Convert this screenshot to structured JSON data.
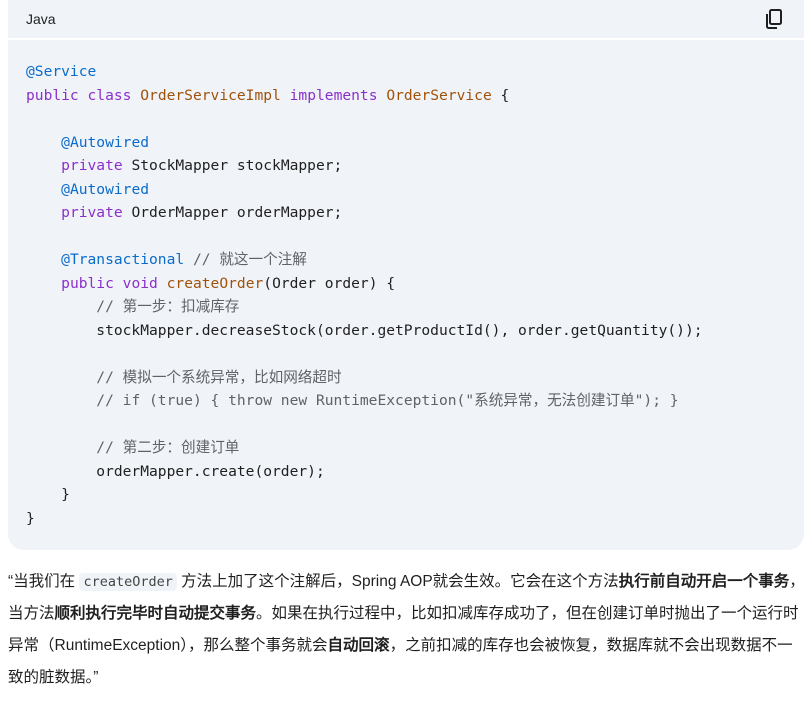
{
  "code_block": {
    "language": "Java",
    "copy_icon": "copy-icon",
    "lines": [
      [
        {
          "t": "anno",
          "v": "@Service"
        }
      ],
      [
        {
          "t": "kw",
          "v": "public"
        },
        {
          "t": "p",
          "v": " "
        },
        {
          "t": "kw",
          "v": "class"
        },
        {
          "t": "p",
          "v": " "
        },
        {
          "t": "type",
          "v": "OrderServiceImpl"
        },
        {
          "t": "p",
          "v": " "
        },
        {
          "t": "kw",
          "v": "implements"
        },
        {
          "t": "p",
          "v": " "
        },
        {
          "t": "type",
          "v": "OrderService"
        },
        {
          "t": "p",
          "v": " {"
        }
      ],
      [
        {
          "t": "p",
          "v": ""
        }
      ],
      [
        {
          "t": "p",
          "v": "    "
        },
        {
          "t": "anno",
          "v": "@Autowired"
        }
      ],
      [
        {
          "t": "p",
          "v": "    "
        },
        {
          "t": "kw",
          "v": "private"
        },
        {
          "t": "p",
          "v": " StockMapper stockMapper;"
        }
      ],
      [
        {
          "t": "p",
          "v": "    "
        },
        {
          "t": "anno",
          "v": "@Autowired"
        }
      ],
      [
        {
          "t": "p",
          "v": "    "
        },
        {
          "t": "kw",
          "v": "private"
        },
        {
          "t": "p",
          "v": " OrderMapper orderMapper;"
        }
      ],
      [
        {
          "t": "p",
          "v": ""
        }
      ],
      [
        {
          "t": "p",
          "v": "    "
        },
        {
          "t": "anno",
          "v": "@Transactional"
        },
        {
          "t": "p",
          "v": " "
        },
        {
          "t": "cm",
          "v": "// 就这一个注解"
        }
      ],
      [
        {
          "t": "p",
          "v": "    "
        },
        {
          "t": "kw",
          "v": "public"
        },
        {
          "t": "p",
          "v": " "
        },
        {
          "t": "kw",
          "v": "void"
        },
        {
          "t": "p",
          "v": " "
        },
        {
          "t": "fn",
          "v": "createOrder"
        },
        {
          "t": "p",
          "v": "(Order order) {"
        }
      ],
      [
        {
          "t": "p",
          "v": "        "
        },
        {
          "t": "cm",
          "v": "// 第一步：扣减库存"
        }
      ],
      [
        {
          "t": "p",
          "v": "        stockMapper.decreaseStock(order.getProductId(), order.getQuantity());"
        }
      ],
      [
        {
          "t": "p",
          "v": ""
        }
      ],
      [
        {
          "t": "p",
          "v": "        "
        },
        {
          "t": "cm",
          "v": "// 模拟一个系统异常，比如网络超时"
        }
      ],
      [
        {
          "t": "p",
          "v": "        "
        },
        {
          "t": "cm",
          "v": "// if (true) { throw new RuntimeException(\"系统异常，无法创建订单\"); }"
        }
      ],
      [
        {
          "t": "p",
          "v": ""
        }
      ],
      [
        {
          "t": "p",
          "v": "        "
        },
        {
          "t": "cm",
          "v": "// 第二步：创建订单"
        }
      ],
      [
        {
          "t": "p",
          "v": "        orderMapper.create(order);"
        }
      ],
      [
        {
          "t": "p",
          "v": "    }"
        }
      ],
      [
        {
          "t": "p",
          "v": "}"
        }
      ]
    ]
  },
  "prose": {
    "segments": [
      {
        "t": "p",
        "v": "“当我们在 "
      },
      {
        "t": "code",
        "v": "createOrder"
      },
      {
        "t": "p",
        "v": " 方法上加了这个注解后，Spring AOP就会生效。它会在这个方法"
      },
      {
        "t": "b",
        "v": "执行前自动开启一个事务"
      },
      {
        "t": "p",
        "v": "，当方法"
      },
      {
        "t": "b",
        "v": "顺利执行完毕时自动提交事务"
      },
      {
        "t": "p",
        "v": "。如果在执行过程中，比如扣减库存成功了，但在创建订单时抛出了一个运行时异常（RuntimeException），那么整个事务就会"
      },
      {
        "t": "b",
        "v": "自动回滚"
      },
      {
        "t": "p",
        "v": "，之前扣减的库存也会被恢复，数据库就不会出现数据不一致的脏数据。”"
      }
    ]
  }
}
